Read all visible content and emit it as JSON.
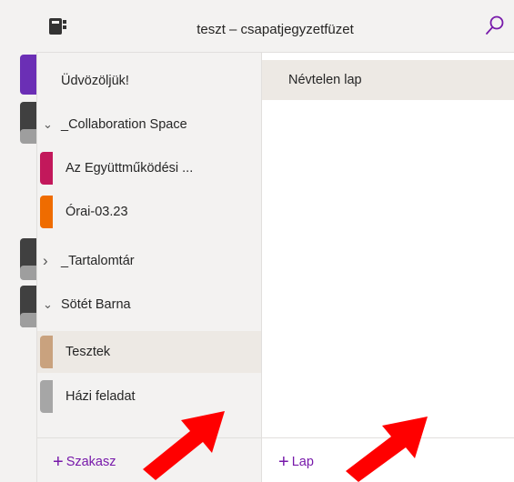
{
  "header": {
    "title": "teszt – csapatjegyzetfüzet"
  },
  "sections": [
    {
      "label": "Üdvözöljük!",
      "type": "section",
      "color": "#6b2fb5"
    },
    {
      "label": "_Collaboration Space",
      "type": "group",
      "expanded": true
    },
    {
      "label": "Az Együttműködési ...",
      "type": "child",
      "color": "#c2185b"
    },
    {
      "label": "Órai-03.23",
      "type": "child",
      "color": "#ef6c00"
    },
    {
      "label": "_Tartalomtár",
      "type": "group",
      "expanded": false
    },
    {
      "label": "Sötét Barna",
      "type": "group",
      "expanded": true
    },
    {
      "label": "Tesztek",
      "type": "child",
      "color": "#c9a27e",
      "selected": true
    },
    {
      "label": "Házi feladat",
      "type": "child",
      "color": "#a6a6a6"
    }
  ],
  "chevrons": {
    "expanded": "⌄",
    "collapsed": "›"
  },
  "pages": [
    {
      "label": "Névtelen lap",
      "selected": true
    }
  ],
  "bottom": {
    "add_section_label": "Szakasz",
    "add_page_label": "Lap",
    "plus": "+"
  },
  "colors": {
    "accent": "#7719aa",
    "arrow": "#ff0000",
    "notebook_purple": "#6b2fb5",
    "notebook_dark": "#404040"
  },
  "icons": {
    "notebook": "notebook-icon",
    "search": "search-icon"
  }
}
